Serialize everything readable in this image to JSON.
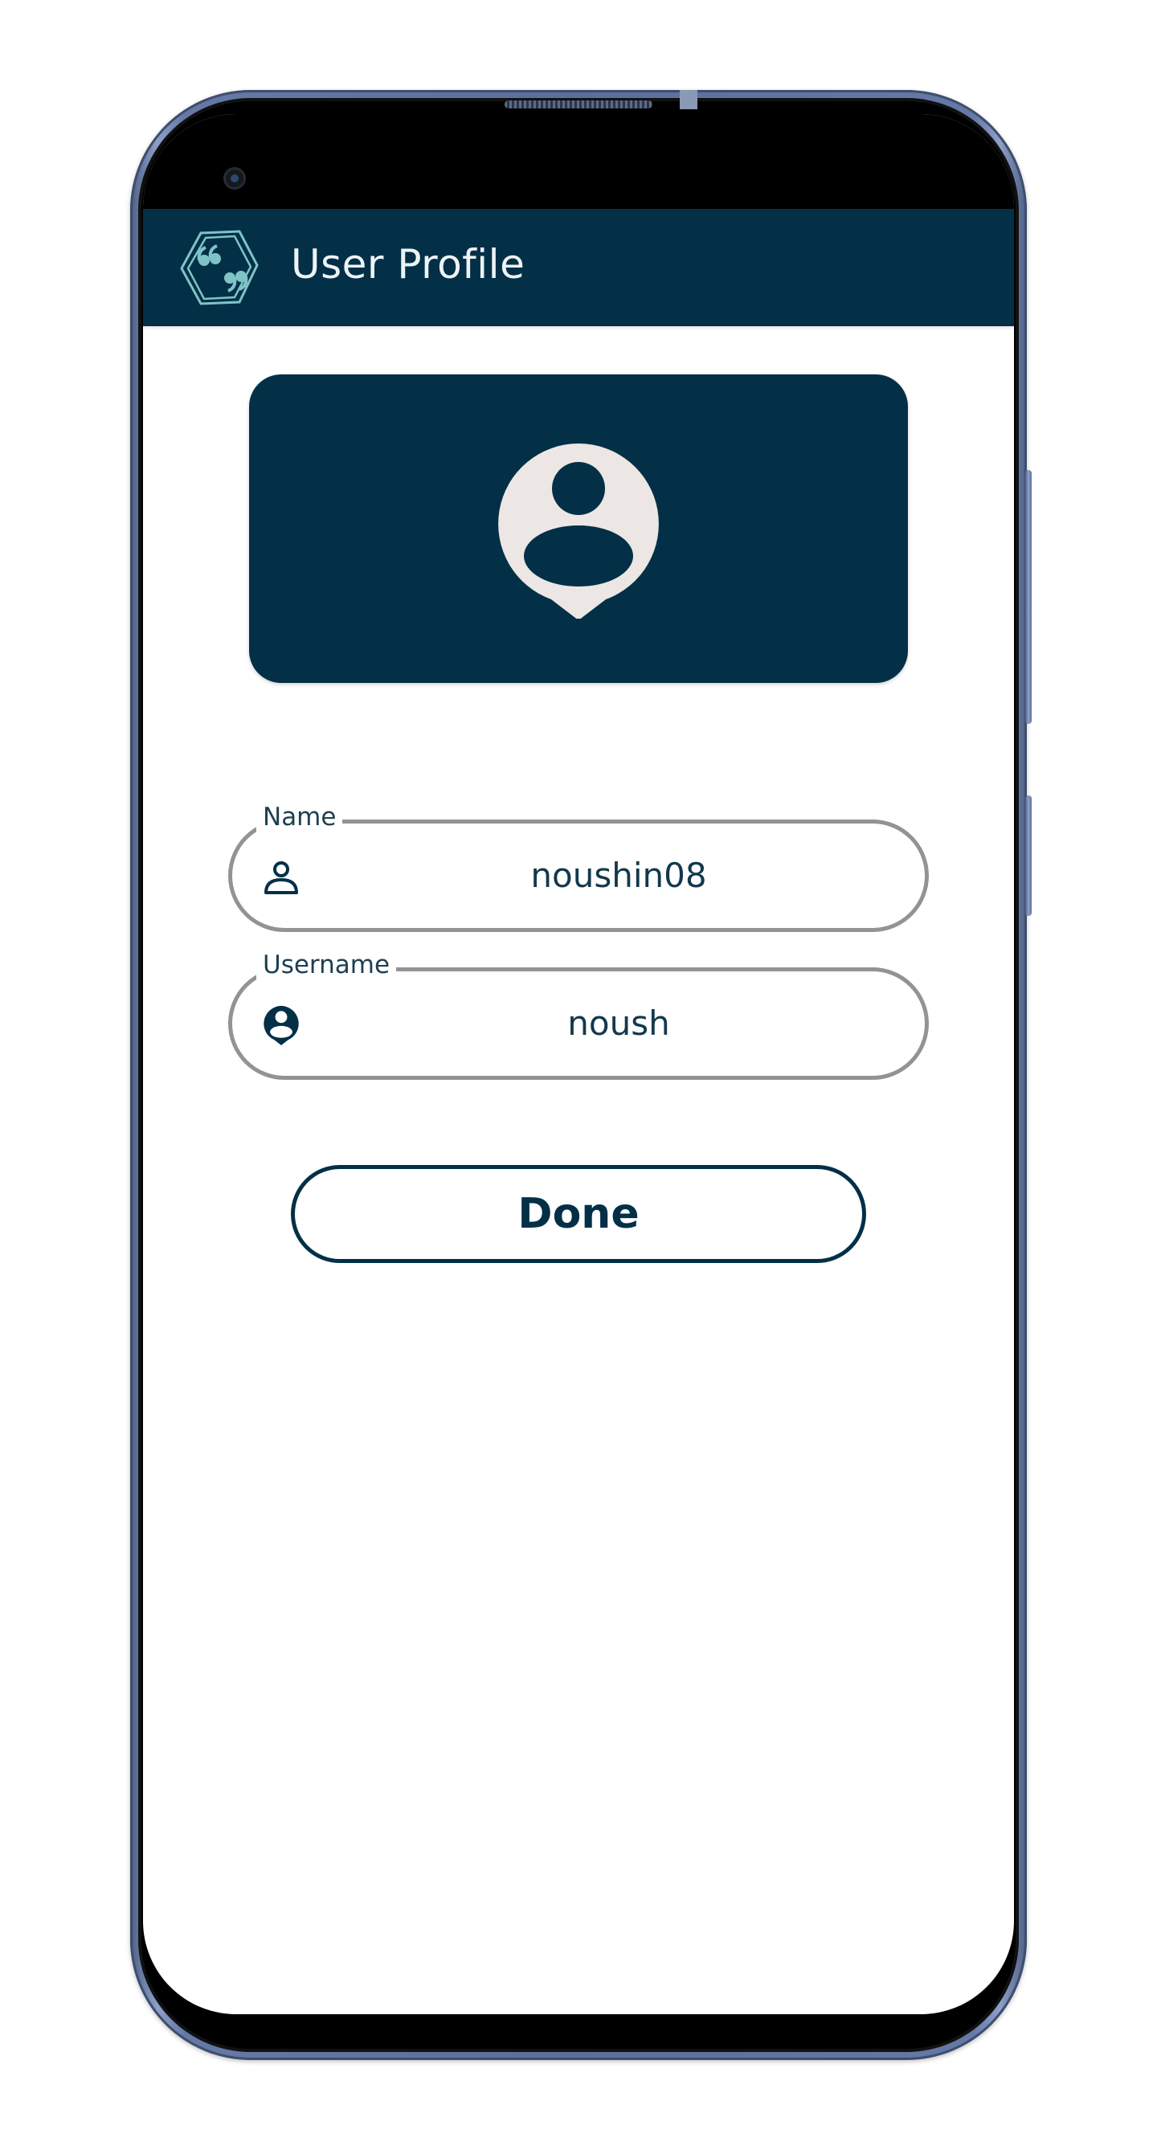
{
  "app_bar": {
    "title": "User Profile",
    "logo_icon": "quote-hexagon-icon",
    "background_color": "#033047"
  },
  "avatar_card": {
    "icon": "profile-avatar-icon",
    "background_color": "#033047",
    "icon_color": "#ece7e4"
  },
  "form": {
    "name_field": {
      "label": "Name",
      "value": "noushin08",
      "icon": "person-outline-icon"
    },
    "username_field": {
      "label": "Username",
      "value": "noush",
      "icon": "account-circle-pin-icon"
    },
    "done_label": "Done"
  },
  "colors": {
    "primary": "#033047",
    "field_border": "#939393",
    "logo_accent": "#7fc3c6"
  }
}
